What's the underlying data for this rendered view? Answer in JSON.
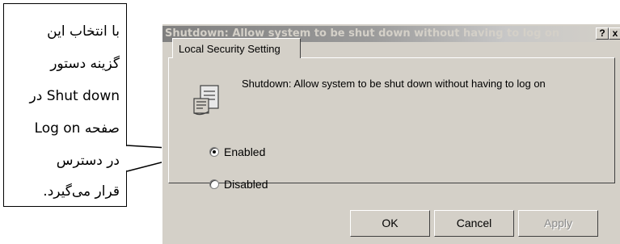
{
  "callout": {
    "lines": [
      "با انتخاب این",
      "گزینه دستور",
      "Shut down در",
      "صفحه Log on",
      "در دسترس",
      "قرار می‌گیرد."
    ]
  },
  "dialog": {
    "title": "Shutdown: Allow system to be shut down without having to log on",
    "help_button": "?",
    "close_button": "x",
    "tab_label": "Local Security Setting",
    "policy_description": "Shutdown: Allow system to be shut down without having to log on",
    "options": [
      {
        "label": "Enabled",
        "checked": true
      },
      {
        "label": "Disabled",
        "checked": false
      }
    ],
    "buttons": {
      "ok": "OK",
      "cancel": "Cancel",
      "apply": "Apply"
    }
  }
}
